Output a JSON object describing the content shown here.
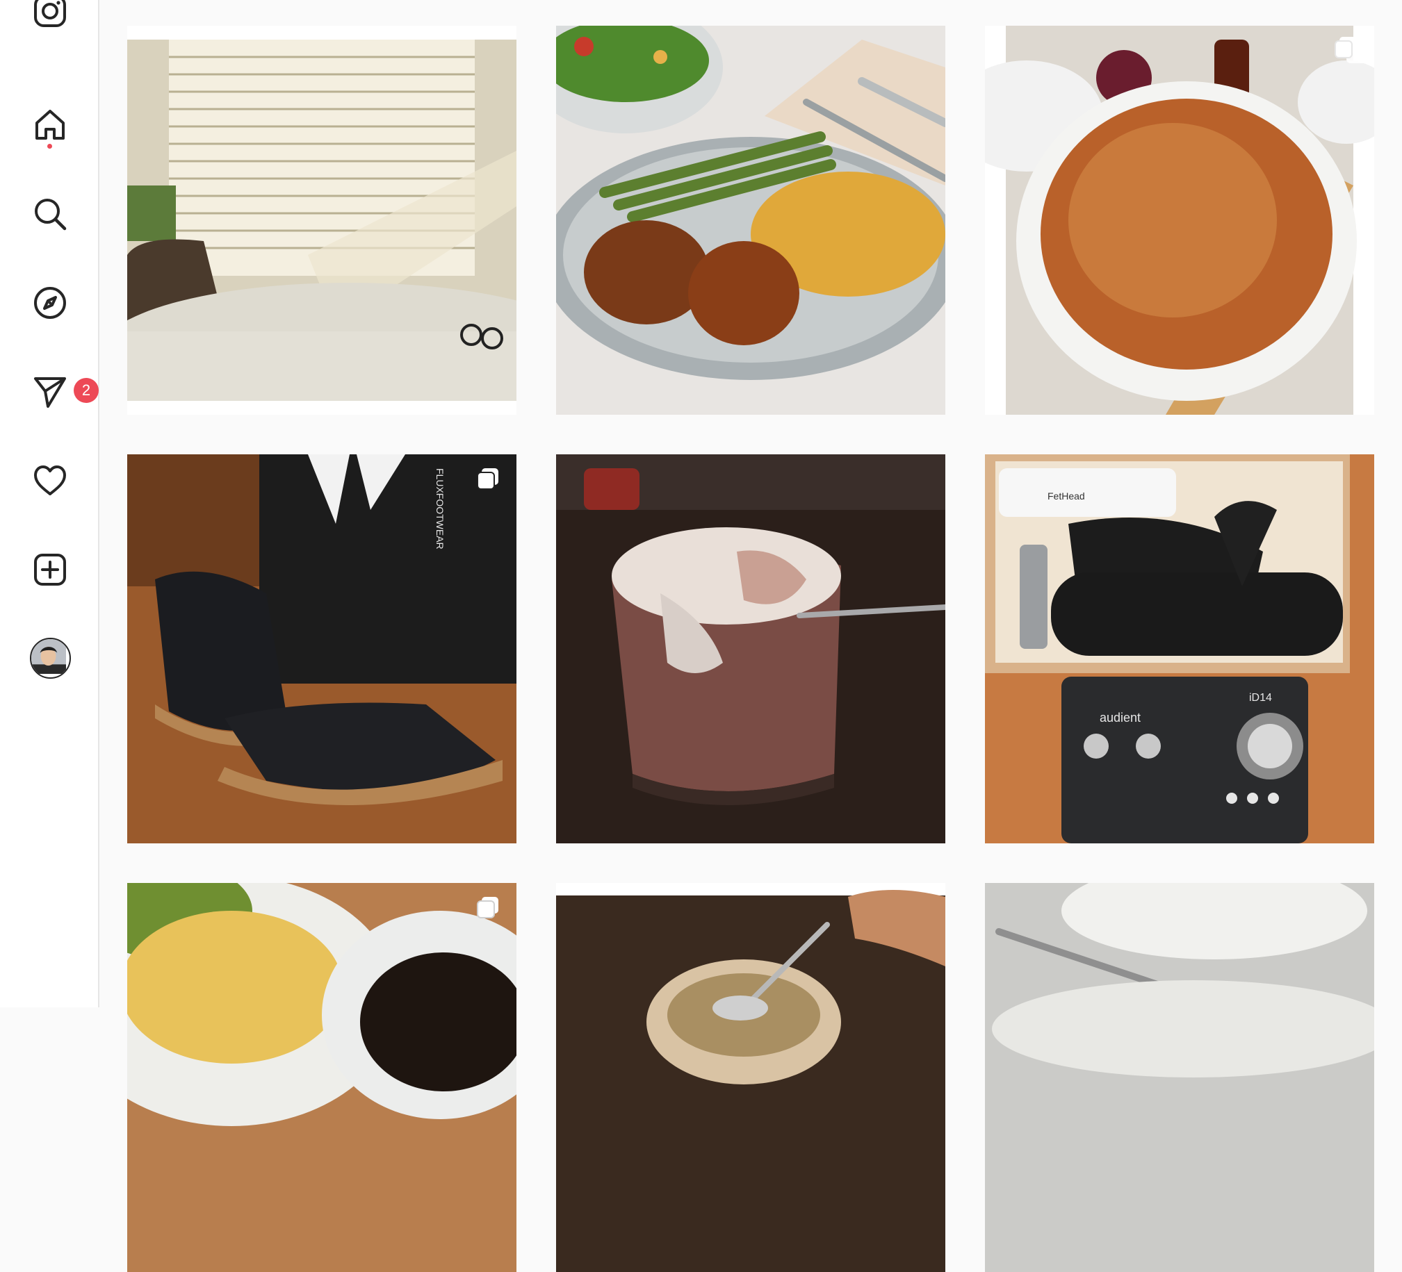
{
  "colors": {
    "notification_red": "#ed4956",
    "icon": "#262626",
    "sidebar_bg": "#ffffff",
    "page_bg": "#fafafa"
  },
  "sidebar": {
    "logo_icon": "instagram-icon",
    "items": [
      {
        "id": "home",
        "icon": "home-icon",
        "active_dot": true
      },
      {
        "id": "search",
        "icon": "search-icon"
      },
      {
        "id": "explore",
        "icon": "compass-icon"
      },
      {
        "id": "messages",
        "icon": "direct-message-icon",
        "badge": "2"
      },
      {
        "id": "notifications",
        "icon": "heart-icon"
      },
      {
        "id": "create",
        "icon": "plus-square-icon"
      },
      {
        "id": "profile",
        "icon": "avatar"
      }
    ]
  },
  "posts": [
    {
      "subject": "window blinds and table",
      "multi": false
    },
    {
      "subject": "chicken asparagus rice plate",
      "multi": false
    },
    {
      "subject": "baked casserole",
      "multi": true
    },
    {
      "subject": "black sneakers and box",
      "multi": true,
      "box_text": "FLUXFOOTWEAR"
    },
    {
      "subject": "iced drink glass",
      "multi": false
    },
    {
      "subject": "microphone and audio interface",
      "multi": false,
      "labels": [
        "FetHead",
        "audient",
        "iD14"
      ]
    },
    {
      "subject": "scrambled eggs and coffee",
      "multi": true
    },
    {
      "subject": "spoon in cup",
      "multi": false
    },
    {
      "subject": "bowl and spoon",
      "multi": false
    }
  ]
}
